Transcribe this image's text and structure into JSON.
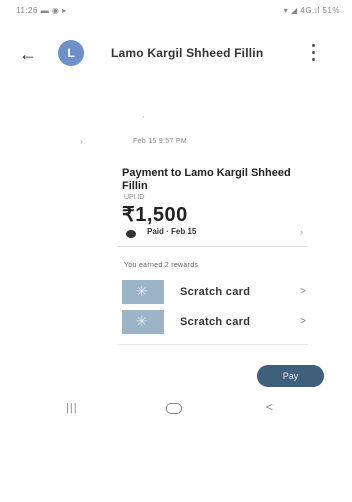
{
  "status_bar": {
    "left": "11:26 ▬ ◉ ▸",
    "right": "▾ ◢ 4G.ıl 51%"
  },
  "app_bar": {
    "avatar_letter": "L",
    "title": "Lamo Kargil Shheed Fillin",
    "icons": {
      "back": "back-arrow-icon",
      "more": "more-vert-icon"
    }
  },
  "meta": {
    "faint_mark": "·",
    "side_mark": "›",
    "sub_line": "Feb 15 9:57 PM"
  },
  "payment": {
    "title": "Payment to Lamo Kargil Shheed Fillin",
    "subtitle": "UPI ID",
    "amount": "₹1,500",
    "status": "Paid · Feb 15",
    "status_arrow": "›"
  },
  "rewards": {
    "earned_text": "You earned 2 rewards",
    "items": [
      {
        "label": "Scratch card",
        "chevron": ">"
      },
      {
        "label": "Scratch card",
        "chevron": ">"
      }
    ]
  },
  "pay_button": {
    "label": "Pay"
  },
  "nav": {
    "recents": "|||",
    "back": "<"
  },
  "colors": {
    "avatar": "#6e8fc7",
    "pay_button": "#3f5f7a",
    "scratch_thumb": "#9bb4c8"
  }
}
